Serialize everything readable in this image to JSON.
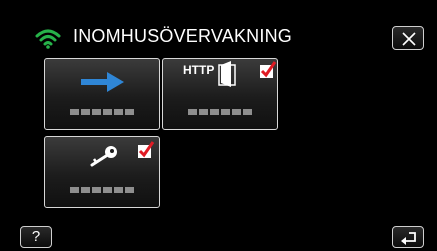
{
  "header": {
    "title": "INOMHUSÖVERVAKNING",
    "status_icon": "wifi-icon",
    "close_icon": "close-x-icon"
  },
  "tiles": [
    {
      "icon": "arrow-right-icon",
      "checked": false
    },
    {
      "icon": "http-door-icon",
      "icon_text": "HTTP",
      "checked": true
    },
    {
      "icon": "key-icon",
      "checked": true
    }
  ],
  "footer": {
    "help_label": "?",
    "back_icon": "return-arrow-icon"
  },
  "colors": {
    "wifi": "#27b34a",
    "arrow": "#2f86d6",
    "check": "#e01b24",
    "background": "#000000"
  }
}
